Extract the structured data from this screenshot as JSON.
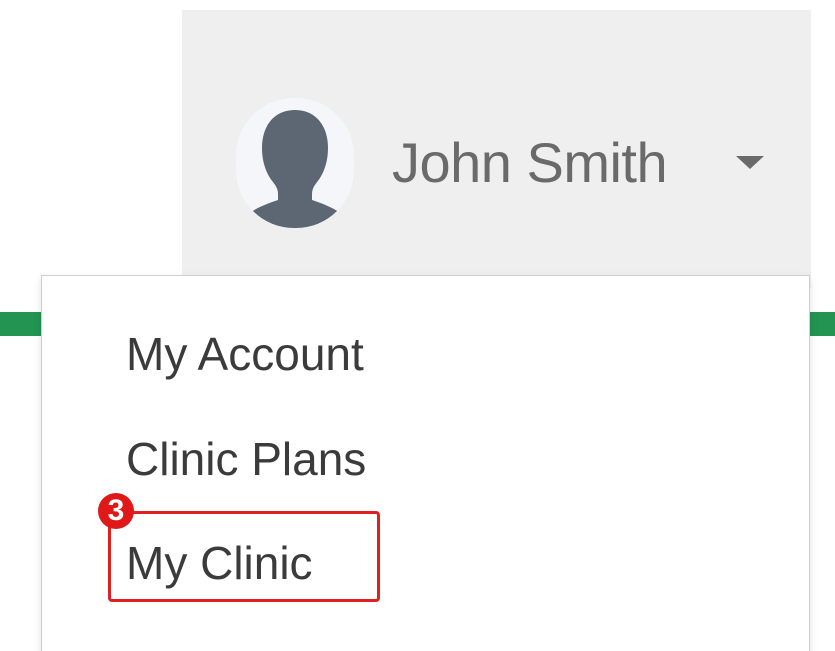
{
  "header": {
    "user_name": "John Smith",
    "avatar_icon": "user-silhouette-icon",
    "caret_icon": "caret-down-icon"
  },
  "menu": {
    "items": [
      {
        "label": "My Account"
      },
      {
        "label": "Clinic Plans"
      },
      {
        "label": "My Clinic"
      }
    ]
  },
  "annotation": {
    "step_number": "3",
    "color": "#e02020"
  },
  "colors": {
    "header_bg": "#efefef",
    "accent_green": "#239452",
    "text": "#3b3b3b",
    "name_text": "#6a6a6a"
  }
}
